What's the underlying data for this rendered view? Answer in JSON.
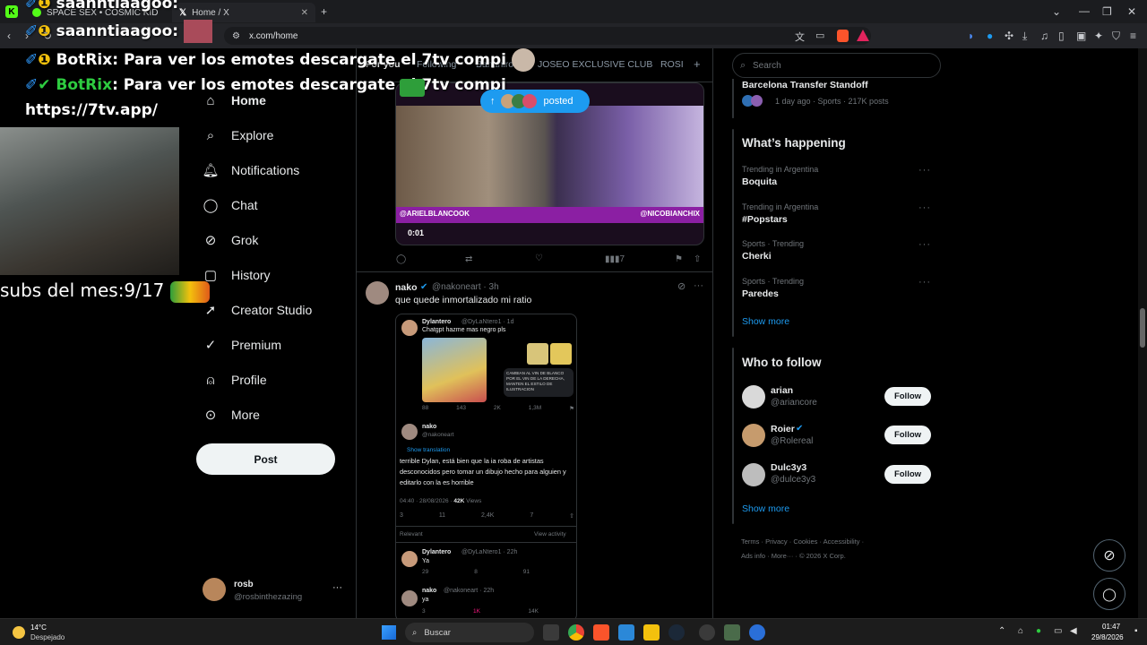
{
  "browser": {
    "tabs": [
      {
        "label": "SPACE SEX • COSMIC KID"
      },
      {
        "label": "Home / X"
      }
    ],
    "url": "x.com/home"
  },
  "overlay": {
    "chat": [
      {
        "user": "saanntiaagoo",
        "text": ":"
      },
      {
        "user": "saanntiaagoo",
        "text": ":"
      },
      {
        "user": "BotRix",
        "text": ": Para ver los emotes descargate el 7tv compi"
      },
      {
        "user": "",
        "text": "https://7tv.app/"
      }
    ],
    "subs_text": "subs del mes:9/17"
  },
  "sidebar": {
    "nav": [
      "Home",
      "Explore",
      "Notifications",
      "Chat",
      "Grok",
      "History",
      "Creator Studio",
      "Premium",
      "Profile",
      "More"
    ],
    "post_label": "Post",
    "account": {
      "name": "rosb",
      "handle": "@rosbinthezazing"
    }
  },
  "feed": {
    "tabs": [
      "For you",
      "Following",
      "Bananirou",
      "JOSEO EXCLUSIVE CLUB",
      "ROSI"
    ],
    "posted_label": "posted",
    "video": {
      "time": "0:01",
      "left_tag": "@ARIELBLANCOOK",
      "right_tag": "@NICOBIANCHIX"
    },
    "post1_views": "7",
    "post2": {
      "name": "nako",
      "handle": "@nakoneart · 3h",
      "text": "que quede inmortalizado mi ratio",
      "embed": {
        "q_name": "Dylantero",
        "q_handle": "@DyLaNtero1 · 1d",
        "q_text": "Chatgpt hazme mas negro pls",
        "q_caption": "CAMBIAN AL VIN DE BLANCO POR EL VIN DE LA DERECHA, MANTEN EL ESTILO DE ILUSTRACION",
        "q_stats": [
          "88",
          "143",
          "2K",
          "1,3M"
        ],
        "r_name": "nako",
        "r_handle": "@nakoneart",
        "show_translation": "Show translation",
        "r_text": "terrible Dylan, está bien que la ia roba de artistas desconocidos pero tomar un dibujo hecho para alguien y editarlo con la es horrible",
        "r_time": "04:40 · 28/08/2026 · ",
        "r_views": "42K",
        "r_views_label": "Views",
        "r_stats": [
          "3",
          "11",
          "2,4K",
          "7"
        ],
        "relevant": "Relevant",
        "view_activity": "View activity",
        "c1_name": "Dylantero",
        "c1_handle": "@DyLaNtero1 · 22h",
        "c1_text": "Ya",
        "c1_stats": [
          "29",
          "8",
          "91"
        ],
        "c2_name": "nako",
        "c2_handle": "@nakoneart · 22h",
        "c2_text": "ya",
        "c2_stats": [
          "3",
          "1K",
          "14K"
        ]
      }
    }
  },
  "right": {
    "search_placeholder": "Search",
    "top_story": {
      "title": "Barcelona Transfer Standoff",
      "meta": "1 day ago · Sports · 217K posts"
    },
    "happening_title": "What’s happening",
    "trends": [
      {
        "meta": "Trending in Argentina",
        "title": "Boquita"
      },
      {
        "meta": "Trending in Argentina",
        "title": "#Popstars"
      },
      {
        "meta": "Sports · Trending",
        "title": "Cherki"
      },
      {
        "meta": "Sports · Trending",
        "title": "Paredes"
      }
    ],
    "show_more": "Show more",
    "who_title": "Who to follow",
    "follow": [
      {
        "name": "arian",
        "handle": "@ariancore"
      },
      {
        "name": "Roier",
        "handle": "@Rolereal"
      },
      {
        "name": "Dulc3y3",
        "handle": "@dulce3y3"
      }
    ],
    "follow_label": "Follow",
    "footer1": "Terms · Privacy · Cookies · Accessibility ·",
    "footer2": "Ads info · More··· · © 2026 X Corp."
  },
  "taskbar": {
    "weather_temp": "14°C",
    "weather_desc": "Despejado",
    "search": "Buscar",
    "time": "01:47",
    "date": "29/8/2026"
  },
  "colors": {
    "accent": "#1d9bf0",
    "bg": "#000000",
    "muted": "#71767b"
  }
}
